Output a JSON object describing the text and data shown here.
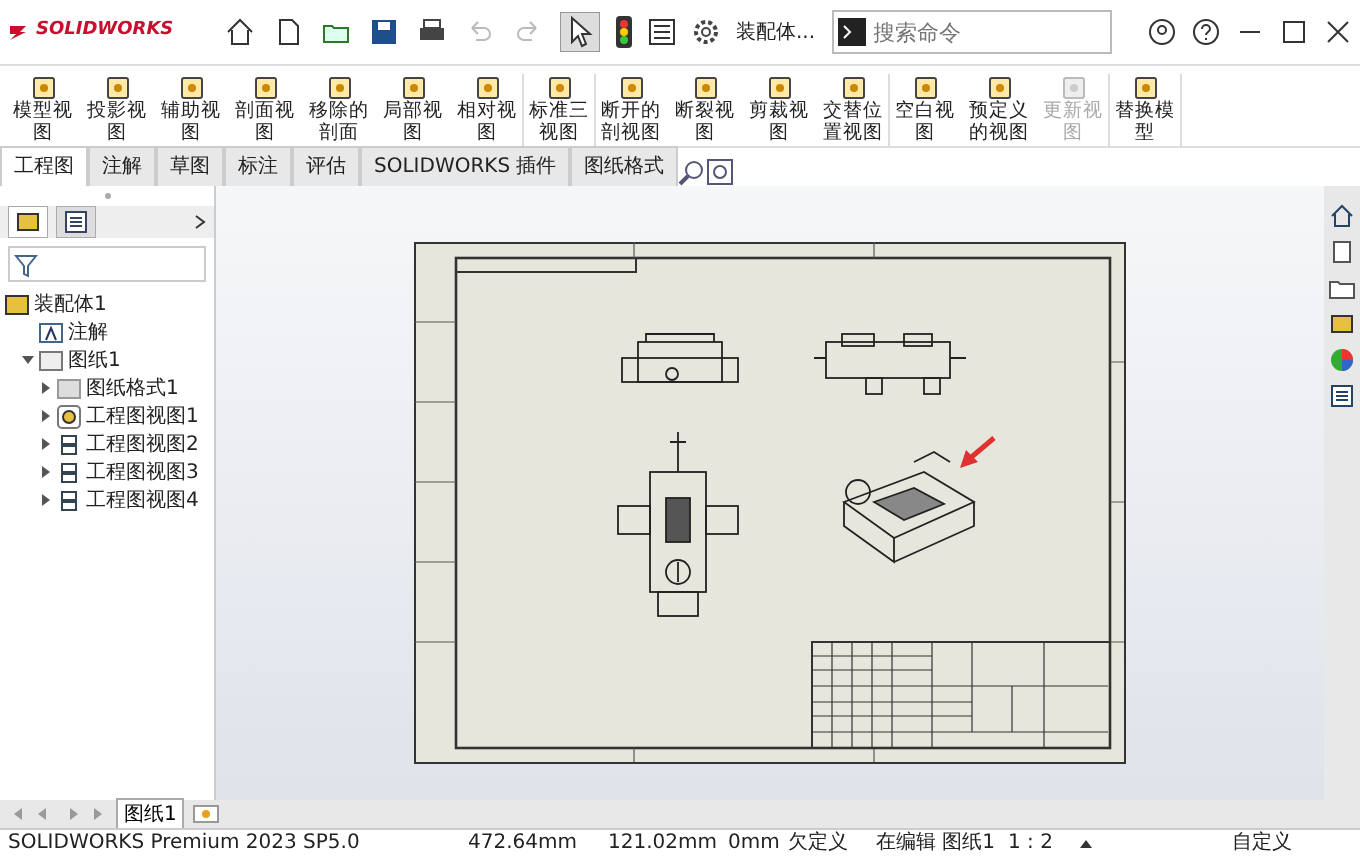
{
  "title_bar": {
    "app_name": "SOLIDWORKS",
    "document": "装配体...",
    "search": {
      "placeholder": "搜索命令"
    }
  },
  "ribbon": {
    "groups": [
      [
        {
          "label": "模型视图",
          "disabled": false
        },
        {
          "label": "投影视图",
          "disabled": false
        },
        {
          "label": "辅助视图",
          "disabled": false
        },
        {
          "label": "剖面视图",
          "disabled": false
        },
        {
          "label": "移除的剖面",
          "disabled": false
        },
        {
          "label": "局部视图",
          "disabled": false
        },
        {
          "label": "相对视图",
          "disabled": false
        }
      ],
      [
        {
          "label": "标准三视图",
          "disabled": false
        }
      ],
      [
        {
          "label": "断开的剖视图",
          "disabled": false
        },
        {
          "label": "断裂视图",
          "disabled": false
        },
        {
          "label": "剪裁视图",
          "disabled": false
        },
        {
          "label": "交替位置视图",
          "disabled": false
        }
      ],
      [
        {
          "label": "空白视图",
          "disabled": false
        },
        {
          "label": "预定义的视图",
          "disabled": false
        },
        {
          "label": "更新视图",
          "disabled": true
        }
      ],
      [
        {
          "label": "替换模型",
          "disabled": false
        }
      ]
    ]
  },
  "tabs": [
    {
      "label": "工程图",
      "selected": true
    },
    {
      "label": "注解",
      "selected": false
    },
    {
      "label": "草图",
      "selected": false
    },
    {
      "label": "标注",
      "selected": false
    },
    {
      "label": "评估",
      "selected": false
    },
    {
      "label": "SOLIDWORKS 插件",
      "selected": false
    },
    {
      "label": "图纸格式",
      "selected": false
    }
  ],
  "feature_tree": {
    "root": "装配体1",
    "children": [
      {
        "label": "注解",
        "kind": "annotation"
      },
      {
        "label": "图纸1",
        "kind": "sheet",
        "expanded": true,
        "children": [
          {
            "label": "图纸格式1",
            "kind": "format",
            "expanded": false
          },
          {
            "label": "工程图视图1",
            "kind": "model-view",
            "expanded": false
          },
          {
            "label": "工程图视图2",
            "kind": "view",
            "expanded": false
          },
          {
            "label": "工程图视图3",
            "kind": "view",
            "expanded": false
          },
          {
            "label": "工程图视图4",
            "kind": "view",
            "expanded": false
          }
        ]
      }
    ]
  },
  "sheet_tabs": [
    {
      "label": "图纸1",
      "selected": true
    }
  ],
  "status_bar": {
    "product": "SOLIDWORKS Premium 2023 SP5.0",
    "x": "472.64mm",
    "y": "121.02mm",
    "z": "0mm",
    "definition": "欠定义",
    "editing": "在编辑 图纸1",
    "scale": "1 : 2",
    "units": "自定义"
  }
}
